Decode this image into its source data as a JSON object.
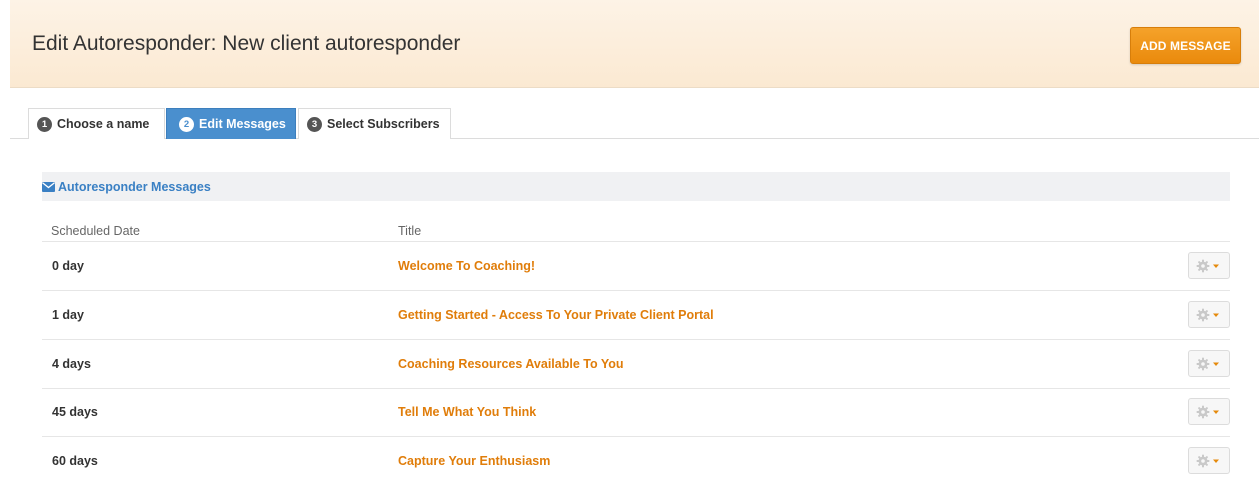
{
  "header": {
    "title": "Edit Autoresponder: New client autoresponder",
    "add_button_label": "ADD MESSAGE"
  },
  "tabs": [
    {
      "num": "1",
      "label": "Choose a name",
      "active": false
    },
    {
      "num": "2",
      "label": "Edit Messages",
      "active": true
    },
    {
      "num": "3",
      "label": "Select Subscribers",
      "active": false
    }
  ],
  "panel": {
    "heading": "Autoresponder Messages",
    "heading_icon": "envelope-icon",
    "columns": {
      "scheduled": "Scheduled Date",
      "title": "Title"
    }
  },
  "messages": [
    {
      "scheduled": "0 day",
      "title": "Welcome To Coaching!"
    },
    {
      "scheduled": "1 day",
      "title": "Getting Started - Access To Your Private Client Portal"
    },
    {
      "scheduled": "4 days",
      "title": "Coaching Resources Available To You"
    },
    {
      "scheduled": "45 days",
      "title": "Tell Me What You Think"
    },
    {
      "scheduled": "60 days",
      "title": "Capture Your Enthusiasm"
    }
  ],
  "row_action_icon": "gear-icon",
  "colors": {
    "accent_orange": "#ea8a0c",
    "tab_active_blue": "#4a8fce",
    "link_orange": "#e07d0a",
    "heading_blue": "#3a80c4"
  }
}
